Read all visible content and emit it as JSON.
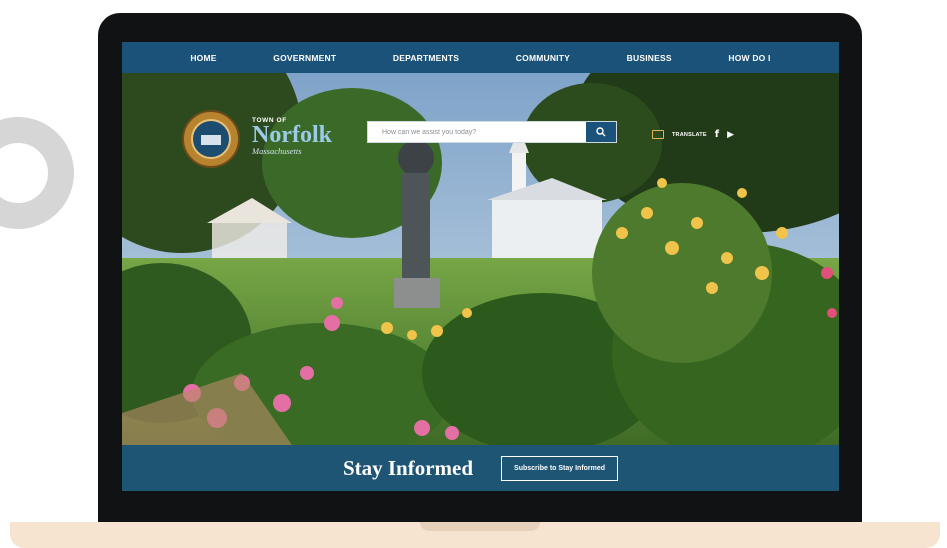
{
  "nav": {
    "items": [
      {
        "label": "HOME"
      },
      {
        "label": "GOVERNMENT"
      },
      {
        "label": "DEPARTMENTS"
      },
      {
        "label": "COMMUNITY"
      },
      {
        "label": "BUSINESS"
      },
      {
        "label": "HOW DO I"
      }
    ]
  },
  "header": {
    "logo_icon": "town-seal-icon",
    "town_of": "TOWN OF",
    "town_name": "Norfolk",
    "state": "Massachusetts"
  },
  "search": {
    "placeholder": "How can we assist you today?",
    "icon": "search-icon"
  },
  "utility": {
    "translate_label": "TRANSLATE",
    "translate_icon": "translate-icon",
    "facebook_icon": "facebook-icon",
    "youtube_icon": "youtube-icon"
  },
  "cta": {
    "heading": "Stay Informed",
    "button_label": "Subscribe to Stay Informed"
  },
  "colors": {
    "nav_blue": "#1b5279",
    "laptop_bezel": "#111214",
    "laptop_base": "#f6e3d0",
    "deco_ring": "#d6d6d6"
  }
}
